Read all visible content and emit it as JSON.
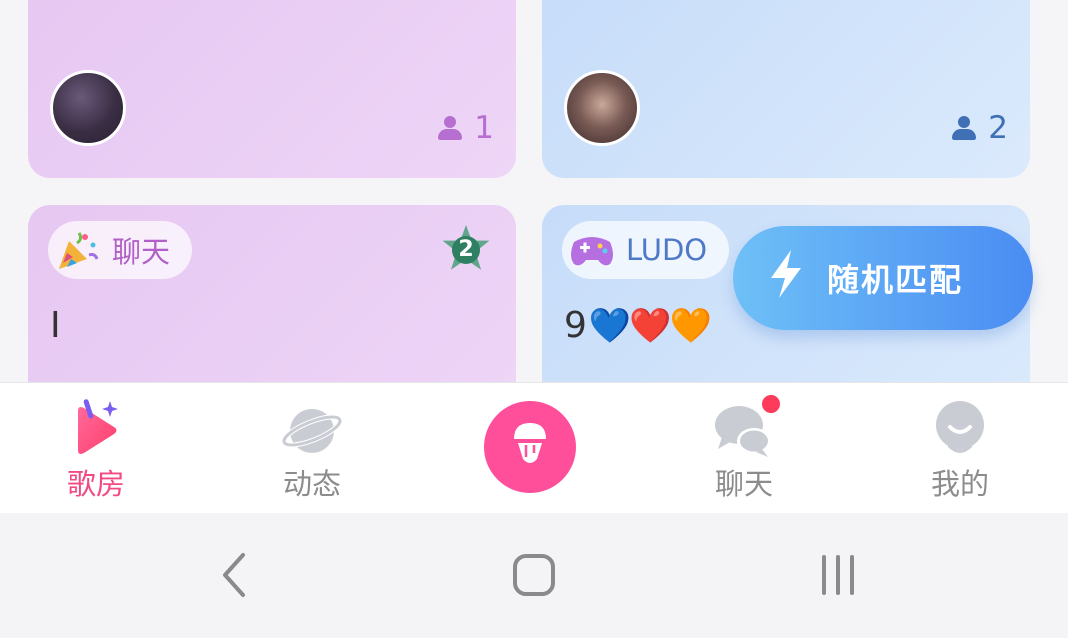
{
  "rooms": [
    {
      "id": "a",
      "theme": "purple",
      "count": "1"
    },
    {
      "id": "b",
      "theme": "blue",
      "count": "2"
    },
    {
      "id": "c",
      "theme": "purple",
      "tag": "聊天",
      "level": "2",
      "text": "I"
    },
    {
      "id": "d",
      "theme": "blue",
      "tag": "LUDO",
      "text": "9",
      "hearts": "💙❤️🧡"
    }
  ],
  "match_button": {
    "label": "随机匹配"
  },
  "tabbar": {
    "tabs": [
      {
        "label": "歌房",
        "active": true,
        "icon": "play-sparkle-icon"
      },
      {
        "label": "动态",
        "active": false,
        "icon": "planet-icon"
      },
      {
        "label": "",
        "active": false,
        "icon": "microphone-icon"
      },
      {
        "label": "聊天",
        "active": false,
        "icon": "chat-bubbles-icon",
        "notification": true
      },
      {
        "label": "我的",
        "active": false,
        "icon": "profile-face-icon"
      }
    ]
  },
  "colors": {
    "accent_pink": "#f24b82",
    "mic_button": "#ff4e9a",
    "match_gradient_start": "#6ec0f7",
    "match_gradient_end": "#4a8cf3",
    "card_purple": "#e6c7f1",
    "card_blue": "#c6dcf9"
  }
}
